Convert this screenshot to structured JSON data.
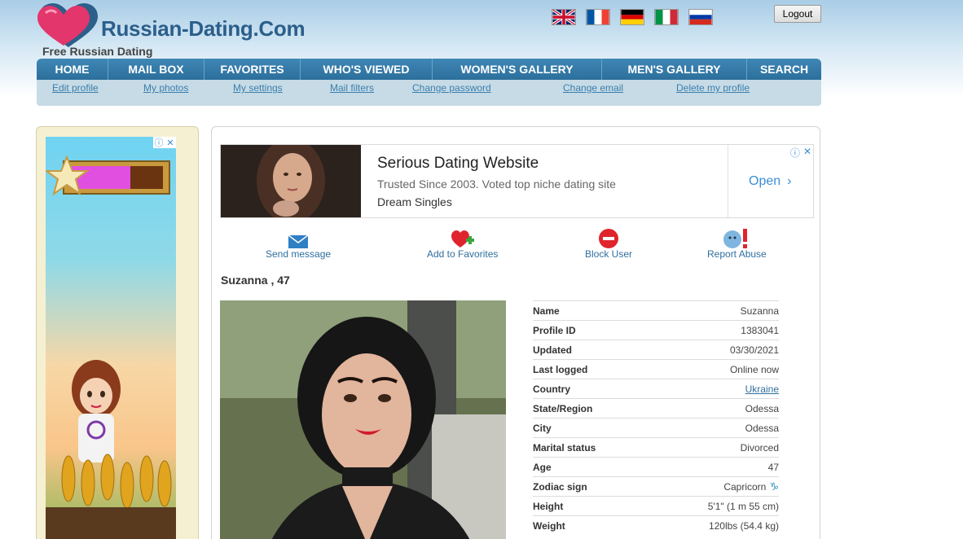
{
  "header": {
    "logo_text": "Russian-Dating.Com",
    "tagline": "Free Russian Dating",
    "logout_label": "Logout",
    "flags": [
      "uk-flag",
      "france-flag",
      "germany-flag",
      "italy-flag",
      "russia-flag"
    ]
  },
  "nav": {
    "items": [
      "HOME",
      "MAIL BOX",
      "FAVORITES",
      "WHO'S VIEWED",
      "WOMEN'S GALLERY",
      "MEN'S GALLERY",
      "SEARCH"
    ]
  },
  "subnav": {
    "items": [
      "Edit profile",
      "My photos",
      "My settings",
      "Mail filters",
      "Change password",
      "Change email",
      "Delete my profile"
    ]
  },
  "ad": {
    "title": "Serious Dating Website",
    "subtitle": "Trusted Since 2003. Voted top niche dating site",
    "brand": "Dream Singles",
    "cta": "Open"
  },
  "actions": {
    "send": "Send message",
    "favorite": "Add to Favorites",
    "block": "Block User",
    "report": "Report Abuse"
  },
  "profile": {
    "title": "Suzanna , 47",
    "fields": [
      {
        "key": "Name",
        "value": "Suzanna"
      },
      {
        "key": "Profile ID",
        "value": "1383041"
      },
      {
        "key": "Updated",
        "value": "03/30/2021"
      },
      {
        "key": "Last logged",
        "value": "Online now"
      },
      {
        "key": "Country",
        "value": "Ukraine"
      },
      {
        "key": "State/Region",
        "value": "Odessa"
      },
      {
        "key": "City",
        "value": "Odessa"
      },
      {
        "key": "Marital status",
        "value": "Divorced"
      },
      {
        "key": "Age",
        "value": "47"
      },
      {
        "key": "Zodiac sign",
        "value": "Capricorn"
      },
      {
        "key": "Height",
        "value": "5'1\" (1 m 55 cm)"
      },
      {
        "key": "Weight",
        "value": "120lbs (54.4 kg)"
      }
    ]
  },
  "colors": {
    "nav_bg": "#2c6f9c",
    "link": "#2f6f9f",
    "subnav_bg": "#c6dbe5",
    "left_panel_bg": "#f6f0d3"
  }
}
